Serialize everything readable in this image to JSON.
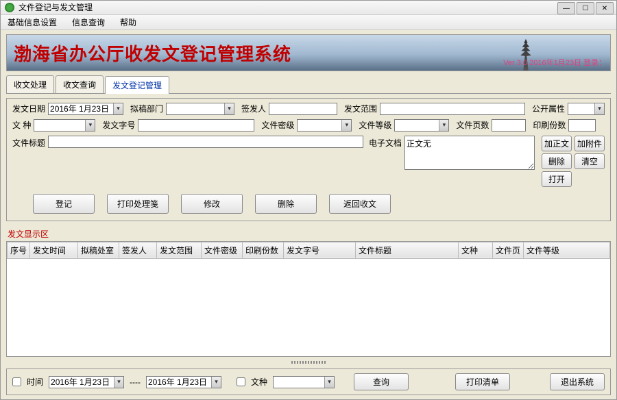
{
  "window": {
    "title": "文件登记与发文管理"
  },
  "menu": {
    "basic": "基础信息设置",
    "query": "信息查询",
    "help": "帮助"
  },
  "banner": {
    "title": "渤海省办公厅收发文登记管理系统",
    "version": "Ver 3.0  2016年1月23日  登录："
  },
  "tabs": {
    "t1": "收文处理",
    "t2": "收文查询",
    "t3": "发文登记管理"
  },
  "form": {
    "date_label": "发文日期",
    "date_value": "2016年 1月23日",
    "drafter_label": "拟稿部门",
    "signer_label": "签发人",
    "scope_label": "发文范围",
    "open_label": "公开属性",
    "kind_label": "文    种",
    "docno_label": "发文字号",
    "secret_label": "文件密级",
    "grade_label": "文件等级",
    "pages_label": "文件页数",
    "copies_label": "印刷份数",
    "title_label": "文件标题",
    "edoc_label": "电子文档",
    "edoc_value": "正文无"
  },
  "btns": {
    "add_body": "加正文",
    "add_attach": "加附件",
    "delete_small": "删除",
    "clear": "清空",
    "open": "打开",
    "register": "登记",
    "print_bag": "打印处理笺",
    "modify": "修改",
    "delete": "删除",
    "return": "返回收文"
  },
  "grid": {
    "title": "发文显示区",
    "cols": {
      "c0": "序号",
      "c1": "发文时间",
      "c2": "拟稿处室",
      "c3": "签发人",
      "c4": "发文范围",
      "c5": "文件密级",
      "c6": "印刷份数",
      "c7": "发文字号",
      "c8": "文件标题",
      "c9": "文种",
      "c10": "文件页",
      "c11": "文件等级"
    }
  },
  "footer": {
    "time_label": "时间",
    "date1": "2016年 1月23日",
    "date2": "2016年 1月23日",
    "kind_label": "文种",
    "query": "查询",
    "print_list": "打印清单",
    "exit": "退出系统"
  }
}
